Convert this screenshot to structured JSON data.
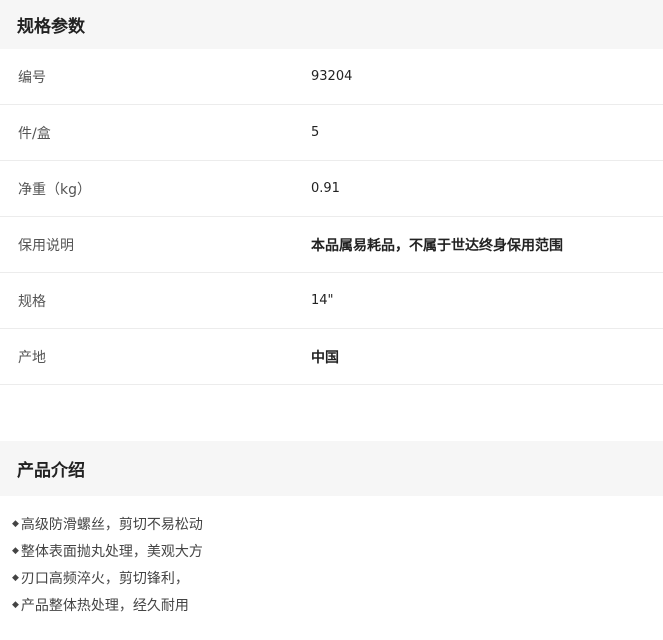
{
  "specs_section": {
    "title": "规格参数",
    "rows": [
      {
        "label": "编号",
        "value": "93204",
        "bold": false
      },
      {
        "label": "件/盒",
        "value": "5",
        "bold": false
      },
      {
        "label": "净重（kg）",
        "value": "0.91",
        "bold": false
      },
      {
        "label": "保用说明",
        "value": "本品属易耗品，不属于世达终身保用范围",
        "bold": true
      },
      {
        "label": "规格",
        "value": "14\"",
        "bold": false
      },
      {
        "label": "产地",
        "value": "中国",
        "bold": true
      }
    ]
  },
  "intro_section": {
    "title": "产品介绍",
    "bullet_icon": "diamond-bullet-icon",
    "items": [
      "高级防滑螺丝，剪切不易松动",
      "整体表面抛丸处理，美观大方",
      "刃口高频淬火，剪切锋利，",
      "产品整体热处理，经久耐用"
    ]
  }
}
